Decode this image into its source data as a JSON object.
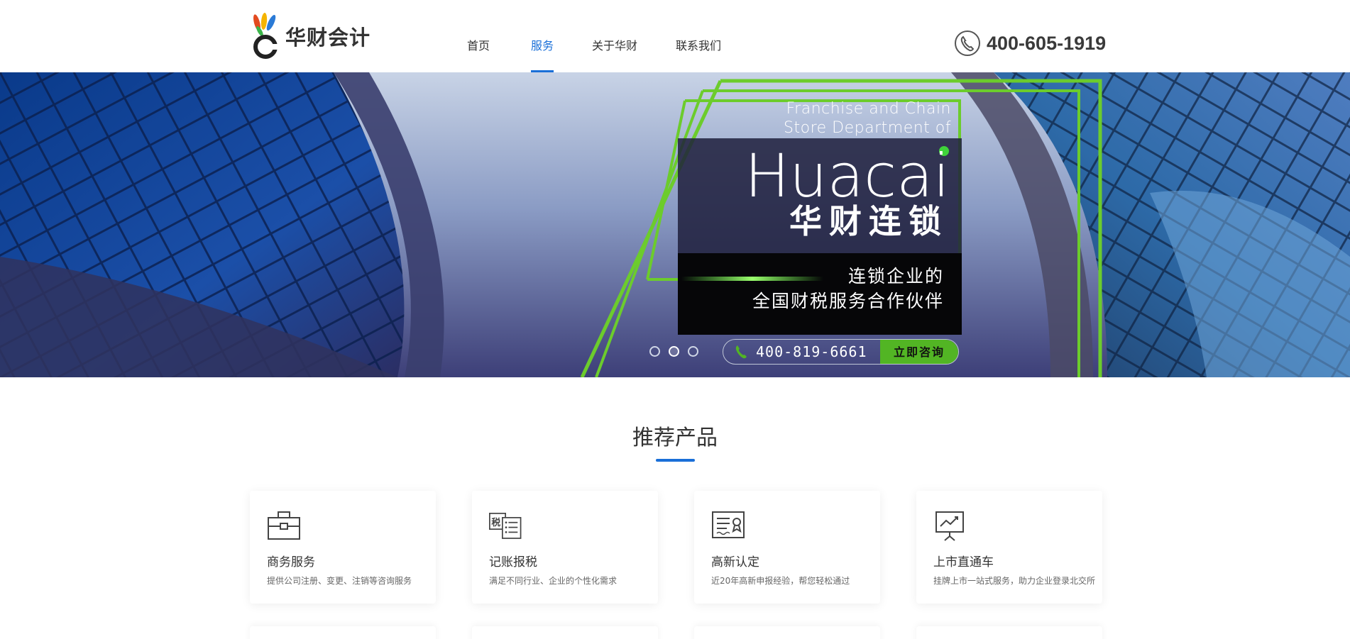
{
  "header": {
    "logo_text": "华财会计",
    "nav": [
      {
        "label": "首页",
        "active": false
      },
      {
        "label": "服务",
        "active": true
      },
      {
        "label": "关于华财",
        "active": false
      },
      {
        "label": "联系我们",
        "active": false
      }
    ],
    "hotline": "400-605-1919"
  },
  "banner": {
    "franchise_line1": "Franchise and Chain",
    "franchise_line2": "Store Department of",
    "brand_en": "Huacai",
    "brand_cn": "华财连锁",
    "slogan_line1": "连锁企业的",
    "slogan_line2": "全国财税服务合作伙伴",
    "phone": "400-819-6661",
    "consult_label": "立即咨询",
    "slides": 3,
    "active_slide": 2
  },
  "section": {
    "title": "推荐产品"
  },
  "products": [
    {
      "title": "商务服务",
      "desc": "提供公司注册、变更、注销等咨询服务",
      "icon": "briefcase-icon"
    },
    {
      "title": "记账报税",
      "desc": "满足不同行业、企业的个性化需求",
      "icon": "tax-ledger-icon"
    },
    {
      "title": "高新认定",
      "desc": "近20年高新申报经验，帮您轻松通过",
      "icon": "certificate-icon"
    },
    {
      "title": "上市直通车",
      "desc": "挂牌上市一站式服务，助力企业登录北交所",
      "icon": "presentation-chart-icon"
    }
  ],
  "colors": {
    "accent_blue": "#1a6fd8",
    "accent_green": "#52b524"
  }
}
